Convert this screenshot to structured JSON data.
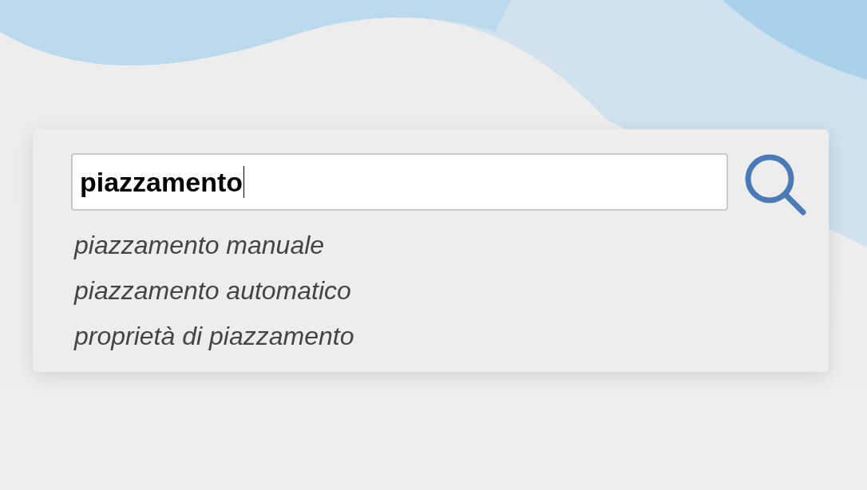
{
  "search": {
    "value": "piazzamento"
  },
  "suggestions": [
    {
      "text": "piazzamento manuale"
    },
    {
      "text": "piazzamento automatico"
    },
    {
      "text": "proprietà di piazzamento"
    }
  ]
}
